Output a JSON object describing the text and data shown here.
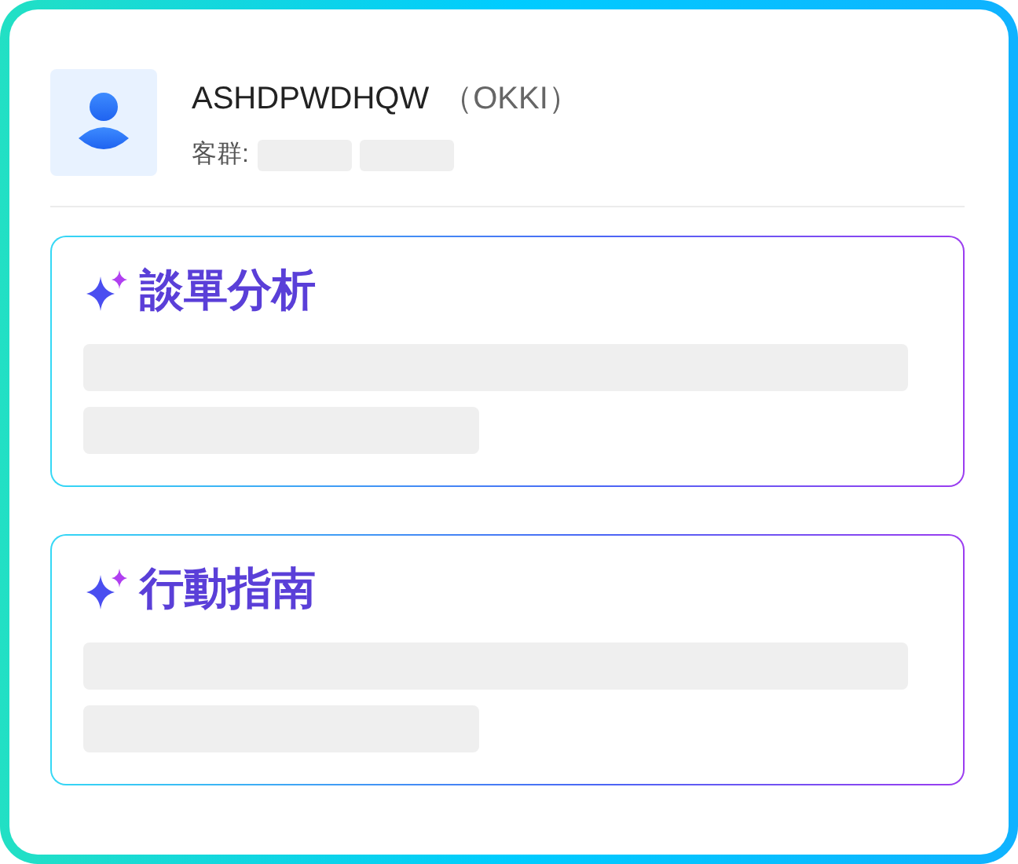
{
  "customer": {
    "name": "ASHDPWDHQW",
    "source": "（OKKI）",
    "group_label": "客群:",
    "group_loading": true
  },
  "sections": [
    {
      "title": "談單分析",
      "loading": true
    },
    {
      "title": "行動指南",
      "loading": true
    }
  ]
}
